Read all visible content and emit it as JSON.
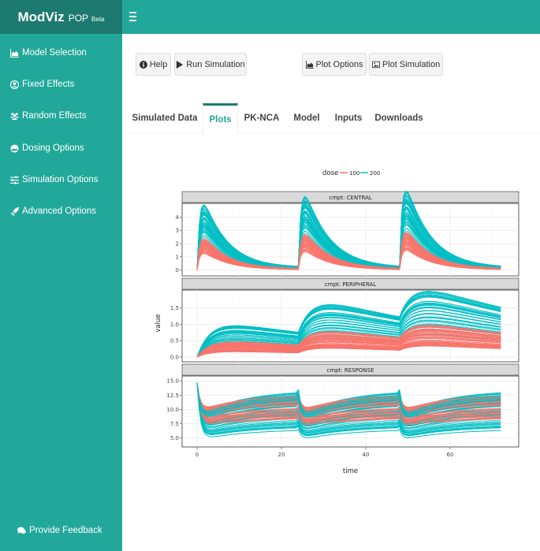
{
  "brand": {
    "name": "ModViz",
    "suffix": "POP",
    "badge": "Beta"
  },
  "sidebar": {
    "items": [
      {
        "label": "Model Selection",
        "icon": "area-chart-icon"
      },
      {
        "label": "Fixed Effects",
        "icon": "user-circle-icon"
      },
      {
        "label": "Random Effects",
        "icon": "users-icon"
      },
      {
        "label": "Dosing Options",
        "icon": "half-circle-icon"
      },
      {
        "label": "Simulation Options",
        "icon": "sliders-icon"
      },
      {
        "label": "Advanced Options",
        "icon": "rocket-icon"
      }
    ],
    "feedback": {
      "label": "Provide Feedback",
      "icon": "comments-icon"
    }
  },
  "toolbar": {
    "help": "Help",
    "run": "Run Simulation",
    "plot_options": "Plot Options",
    "plot_simulation": "Plot Simulation"
  },
  "tabs": [
    {
      "label": "Simulated Data",
      "active": false
    },
    {
      "label": "Plots",
      "active": true
    },
    {
      "label": "PK-NCA",
      "active": false
    },
    {
      "label": "Model",
      "active": false
    },
    {
      "label": "Inputs",
      "active": false
    },
    {
      "label": "Downloads",
      "active": false
    }
  ],
  "colors": {
    "teal_header": "#22a89a",
    "teal_dark": "#1c7a70",
    "dose_100": "#f8766d",
    "dose_200": "#00bfc4"
  },
  "chart_data": {
    "type": "line",
    "xlabel": "time",
    "ylabel": "value",
    "legend": {
      "title": "dose",
      "placement": "top",
      "entries": [
        "100",
        "200"
      ]
    },
    "x_ticks": [
      0,
      20,
      40,
      60
    ],
    "xlim": [
      -3,
      75
    ],
    "dose_times": [
      0,
      24,
      48
    ],
    "x_end": 72,
    "facets": [
      {
        "strip": "cmpt: CENTRAL",
        "ylim": [
          -0.2,
          4.8
        ],
        "y_ticks": [
          0,
          1,
          2,
          3,
          4
        ],
        "y_tick_labels": [
          "0",
          "1",
          "2",
          "3",
          "4"
        ],
        "series": [
          {
            "dose": "100",
            "peak_range": [
              1.1,
              2.1
            ],
            "trough_range": [
              0.05,
              0.3
            ]
          },
          {
            "dose": "200",
            "peak_range": [
              2.2,
              4.5
            ],
            "trough_range": [
              0.15,
              0.6
            ]
          }
        ]
      },
      {
        "strip": "cmpt: PERIPHERAL",
        "ylim": [
          -0.05,
          1.95
        ],
        "y_ticks": [
          0,
          0.5,
          1.0,
          1.5
        ],
        "y_tick_labels": [
          "0.0",
          "0.5",
          "1.0",
          "1.5"
        ],
        "series": [
          {
            "dose": "100",
            "peak_range": [
              0.3,
              0.9
            ],
            "end_range": [
              0.3,
              0.7
            ]
          },
          {
            "dose": "200",
            "peak_range": [
              0.6,
              1.85
            ],
            "end_range": [
              0.7,
              1.3
            ]
          }
        ]
      },
      {
        "strip": "cmpt: RESPONSE",
        "ylim": [
          4.0,
          15.3
        ],
        "y_ticks": [
          5,
          7.5,
          10,
          12.5,
          15
        ],
        "y_tick_labels": [
          "5.0",
          "7.5",
          "10.0",
          "12.5",
          "15.0"
        ],
        "baseline": 14.7,
        "series": [
          {
            "dose": "100",
            "min_range": [
              7.0,
              9.8
            ],
            "end_range": [
              8.5,
              13.0
            ]
          },
          {
            "dose": "200",
            "min_range": [
              4.6,
              9.0
            ],
            "end_range": [
              6.5,
              13.5
            ]
          }
        ]
      }
    ]
  }
}
